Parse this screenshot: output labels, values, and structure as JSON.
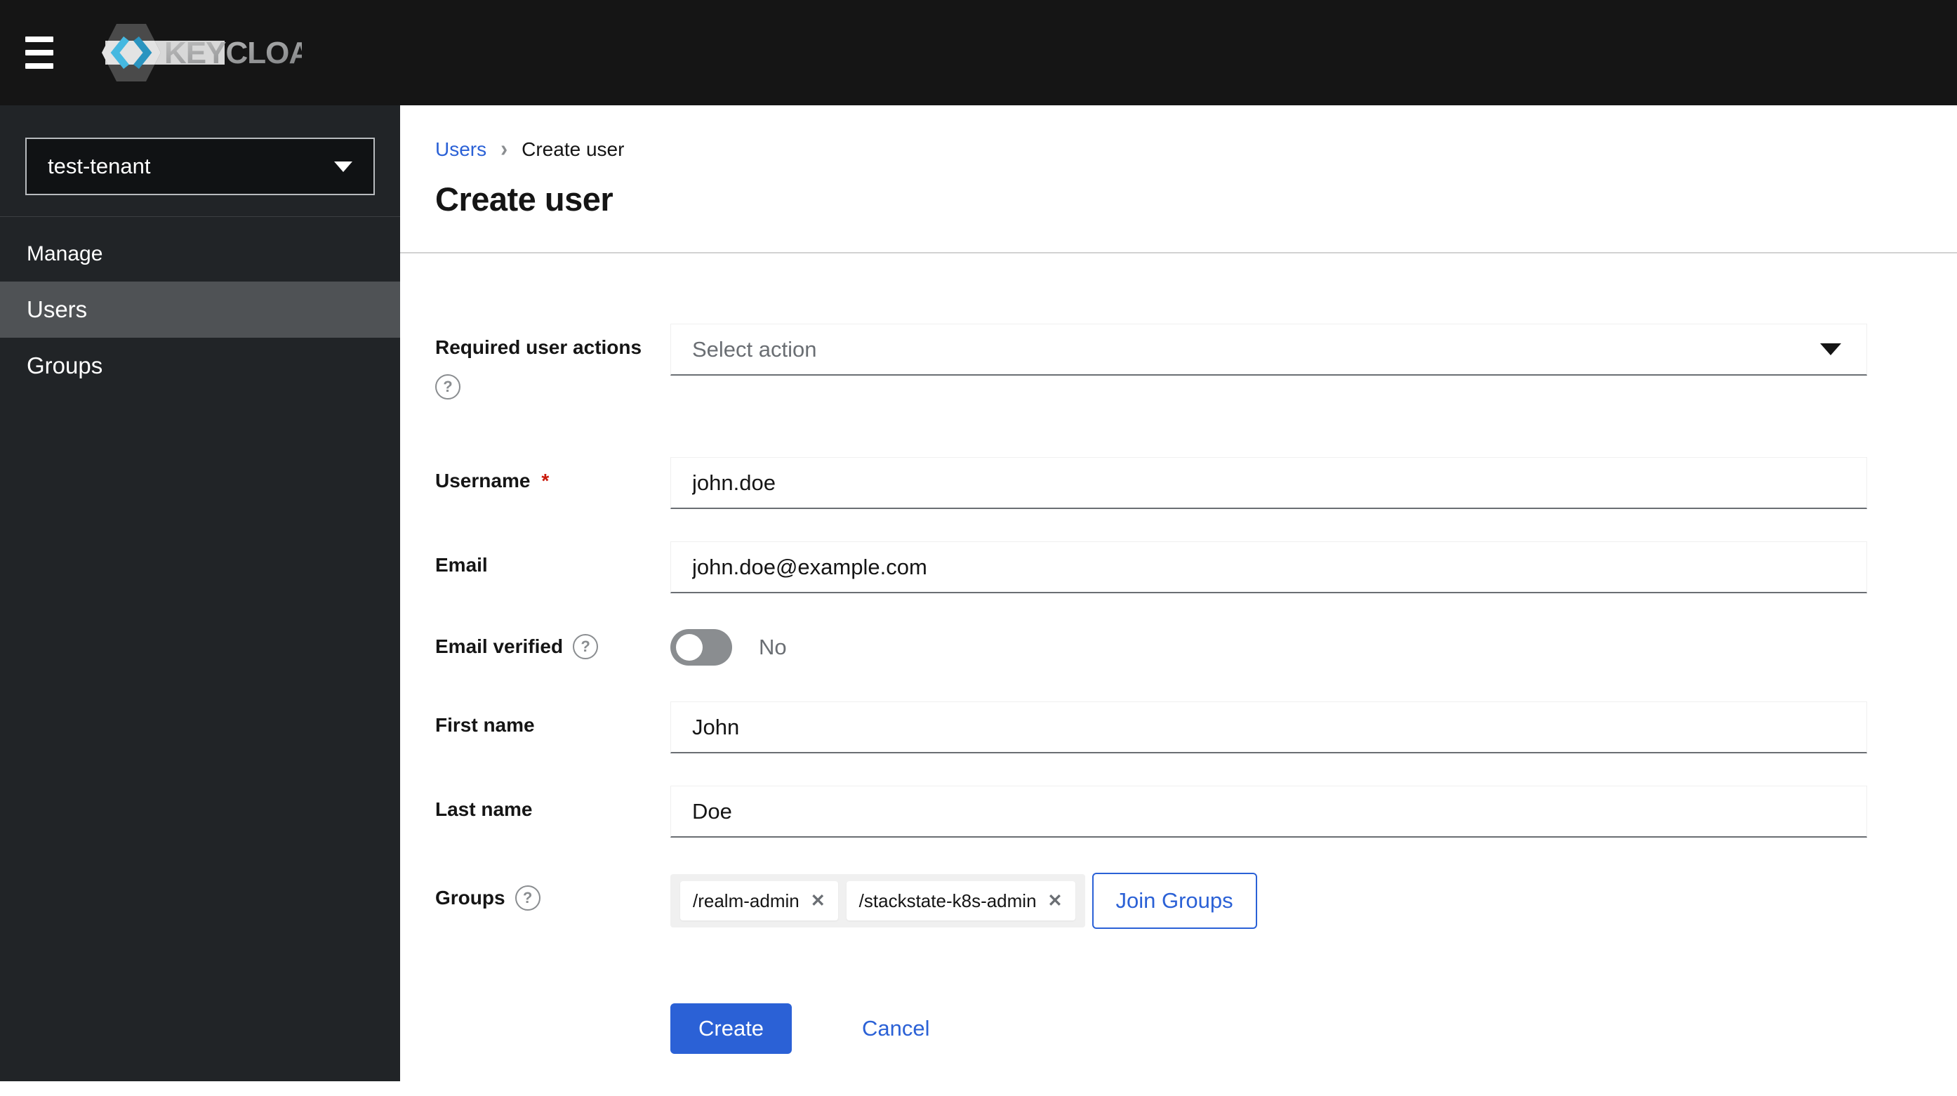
{
  "topbar": {
    "logo_text": "KEYCLOAK"
  },
  "sidebar": {
    "realm_selector": {
      "value": "test-tenant"
    },
    "section_label": "Manage",
    "items": [
      {
        "label": "Users",
        "selected": true
      },
      {
        "label": "Groups",
        "selected": false
      }
    ]
  },
  "breadcrumb": {
    "items": [
      {
        "label": "Users"
      },
      {
        "label": "Create user"
      }
    ]
  },
  "page": {
    "title": "Create user"
  },
  "form": {
    "required_user_actions": {
      "label": "Required user actions",
      "placeholder": "Select action",
      "help": "?"
    },
    "username": {
      "label": "Username",
      "required_marker": "*",
      "value": "john.doe"
    },
    "email": {
      "label": "Email",
      "value": "john.doe@example.com"
    },
    "email_verified": {
      "label": "Email verified",
      "help": "?",
      "state_label": "No",
      "enabled": false
    },
    "first_name": {
      "label": "First name",
      "value": "John"
    },
    "last_name": {
      "label": "Last name",
      "value": "Doe"
    },
    "groups": {
      "label": "Groups",
      "help": "?",
      "chips": [
        {
          "label": "/realm-admin",
          "remove": "✕"
        },
        {
          "label": "/stackstate-k8s-admin",
          "remove": "✕"
        }
      ],
      "join_button_label": "Join Groups"
    },
    "actions": {
      "create_label": "Create",
      "cancel_label": "Cancel"
    }
  },
  "colors": {
    "accent_blue": "#2b61d6",
    "required_red": "#c9190b",
    "topbar_bg": "#151515",
    "sidebar_bg": "#212427",
    "sidebar_selected_bg": "#4f5255",
    "input_bottom_border": "#6a6e73",
    "muted_text": "#6a6e73",
    "icon_gray": "#8a8d90",
    "chip_area_bg": "#f0f0f0",
    "divider": "#d2d2d2"
  }
}
